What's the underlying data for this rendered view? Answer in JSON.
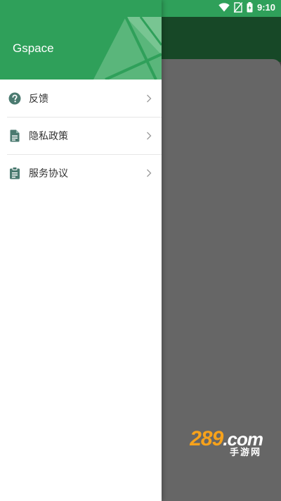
{
  "status_bar": {
    "time": "9:10",
    "icons": [
      "wifi-icon",
      "no-sim-icon",
      "battery-icon"
    ]
  },
  "drawer": {
    "title": "Gspace",
    "items": [
      {
        "label": "反馈",
        "icon": "help-circle-icon"
      },
      {
        "label": "隐私政策",
        "icon": "document-icon"
      },
      {
        "label": "服务协议",
        "icon": "clipboard-icon"
      }
    ]
  },
  "watermark": {
    "logo": "289",
    "logo_suffix": ".com",
    "sub": "手游网"
  },
  "colors": {
    "accent": "#2fa05a",
    "icon": "#4b7a70",
    "scrim_header": "#174827",
    "scrim_body": "#666666"
  }
}
